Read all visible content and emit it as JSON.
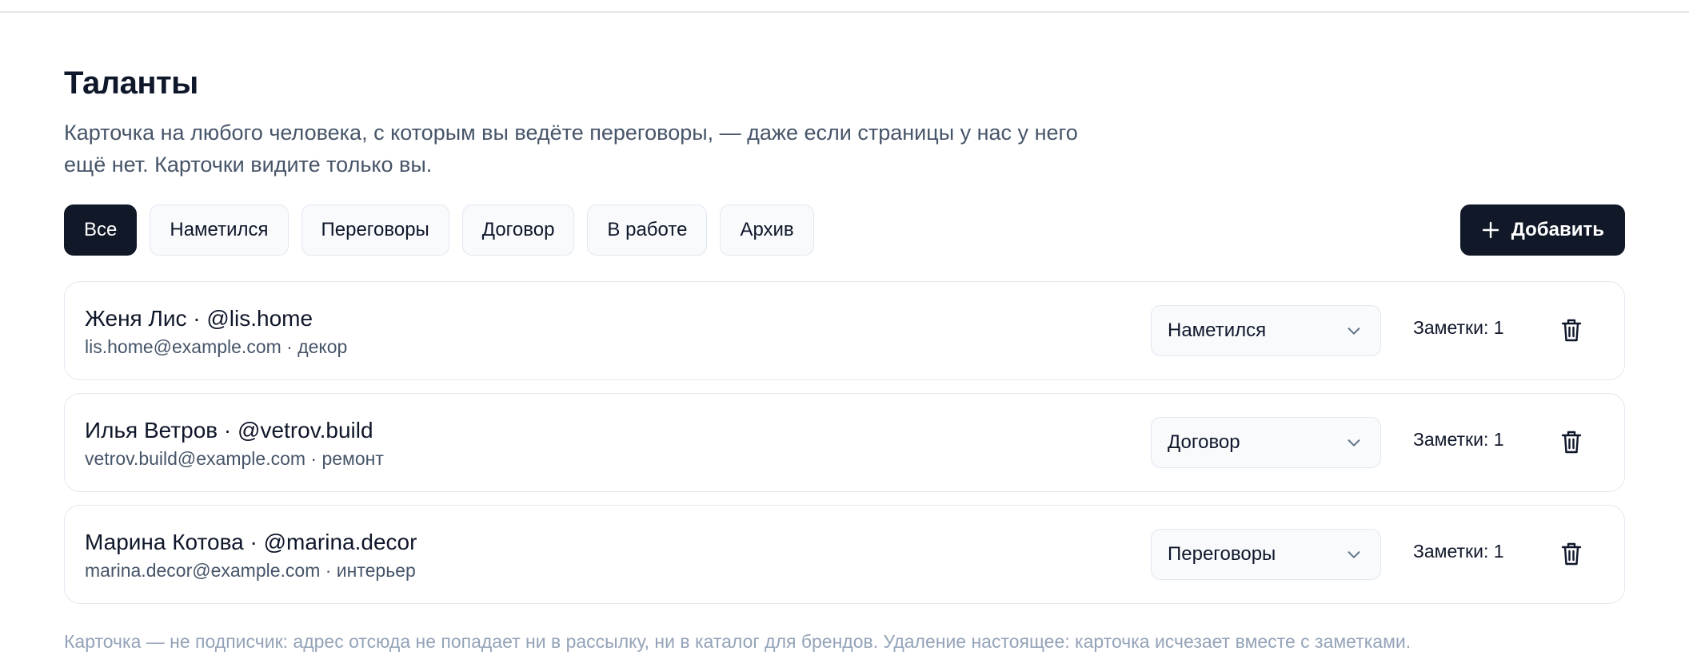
{
  "page": {
    "title": "Таланты",
    "subtitle": "Карточка на любого человека, с которым вы ведёте переговоры, — даже если страницы у нас у него ещё нет. Карточки видите только вы.",
    "footnote": "Карточка — не подписчик: адрес отсюда не попадает ни в рассылку, ни в каталог для брендов. Удаление настоящее: карточка исчезает вместе с заметками."
  },
  "filters": [
    {
      "label": "Все",
      "active": true
    },
    {
      "label": "Наметился",
      "active": false
    },
    {
      "label": "Переговоры",
      "active": false
    },
    {
      "label": "Договор",
      "active": false
    },
    {
      "label": "В работе",
      "active": false
    },
    {
      "label": "Архив",
      "active": false
    }
  ],
  "add_button": {
    "label": "Добавить",
    "icon": "plus-icon"
  },
  "talents": [
    {
      "name": "Женя Лис · @lis.home",
      "meta": "lis.home@example.com · декор",
      "status": "Наметился",
      "notes": "Заметки: 1"
    },
    {
      "name": "Илья Ветров · @vetrov.build",
      "meta": "vetrov.build@example.com · ремонт",
      "status": "Договор",
      "notes": "Заметки: 1"
    },
    {
      "name": "Марина Котова · @marina.decor",
      "meta": "marina.decor@example.com · интерьер",
      "status": "Переговоры",
      "notes": "Заметки: 1"
    }
  ],
  "colors": {
    "primary": "#111827",
    "border": "#e2e8f0",
    "muted_text": "#475569",
    "footnote_text": "#94a3b8"
  },
  "icons": {
    "chevron": "chevron-down-icon",
    "delete": "trash-icon"
  }
}
